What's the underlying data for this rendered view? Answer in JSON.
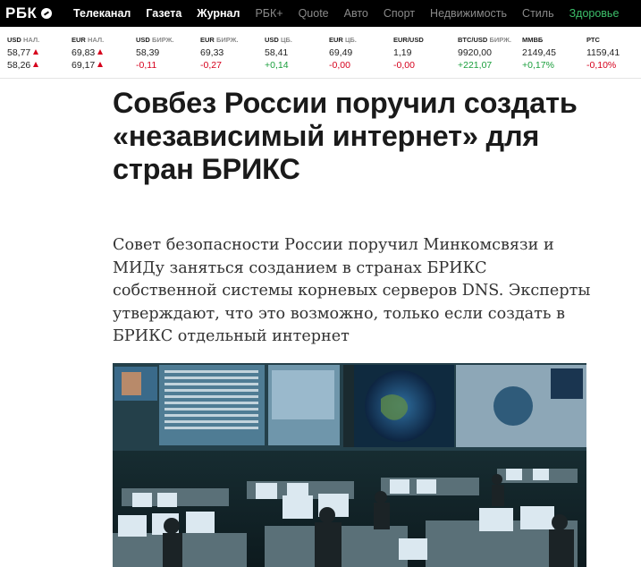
{
  "logo": {
    "text": "РБК",
    "icon": "rbc-globe-icon"
  },
  "nav": [
    {
      "label": "Телеканал",
      "style": "bold"
    },
    {
      "label": "Газета",
      "style": "bold"
    },
    {
      "label": "Журнал",
      "style": "bold"
    },
    {
      "label": "РБК+",
      "style": "dim"
    },
    {
      "label": "Quote",
      "style": "dim"
    },
    {
      "label": "Авто",
      "style": "dim"
    },
    {
      "label": "Спорт",
      "style": "dim"
    },
    {
      "label": "Недвижимость",
      "style": "dim"
    },
    {
      "label": "Стиль",
      "style": "dim"
    },
    {
      "label": "Здоровье",
      "style": "green"
    }
  ],
  "ticker": [
    {
      "name": "USD",
      "sub": "НАЛ.",
      "v1": "58,77",
      "v1_arrow": "up",
      "v2": "58,26",
      "v2_arrow": "up"
    },
    {
      "name": "EUR",
      "sub": "НАЛ.",
      "v1": "69,83",
      "v1_arrow": "up",
      "v2": "69,17",
      "v2_arrow": "up"
    },
    {
      "name": "USD",
      "sub": "БИРЖ.",
      "v1": "58,39",
      "v2": "-0,11",
      "v2_color": "red"
    },
    {
      "name": "EUR",
      "sub": "БИРЖ.",
      "v1": "69,33",
      "v2": "-0,27",
      "v2_color": "red"
    },
    {
      "name": "USD",
      "sub": "ЦБ.",
      "v1": "58,41",
      "v2": "+0,14",
      "v2_color": "green"
    },
    {
      "name": "EUR",
      "sub": "ЦБ.",
      "v1": "69,49",
      "v2": "-0,00",
      "v2_color": "red"
    },
    {
      "name": "EUR/USD",
      "sub": "",
      "v1": "1,19",
      "v2": "-0,00",
      "v2_color": "red"
    },
    {
      "name": "BTC/USD",
      "sub": "БИРЖ.",
      "v1": "9920,00",
      "v2": "+221,07",
      "v2_color": "green"
    },
    {
      "name": "ММВБ",
      "sub": "",
      "v1": "2149,45",
      "v2": "+0,17%",
      "v2_color": "green"
    },
    {
      "name": "РТС",
      "sub": "",
      "v1": "1159,41",
      "v2": "-0,10%",
      "v2_color": "red"
    }
  ],
  "article": {
    "headline": "Совбез России поручил создать «независимый интернет» для стран БРИКС",
    "lead": "Совет безопасности России поручил Минкомсвязи и МИДу заняться созданием в странах БРИКС собственной системы корневых серверов DNS. Эксперты утверждают, что это возможно, только если создать в БРИКС отдельный интернет",
    "photo_subject": "control-room-photo"
  },
  "colors": {
    "nav_bg": "#000000",
    "nav_dim": "#8a8a8a",
    "nav_green": "#3cbf6a",
    "up": "#1a9e3c",
    "down": "#d6001c"
  }
}
